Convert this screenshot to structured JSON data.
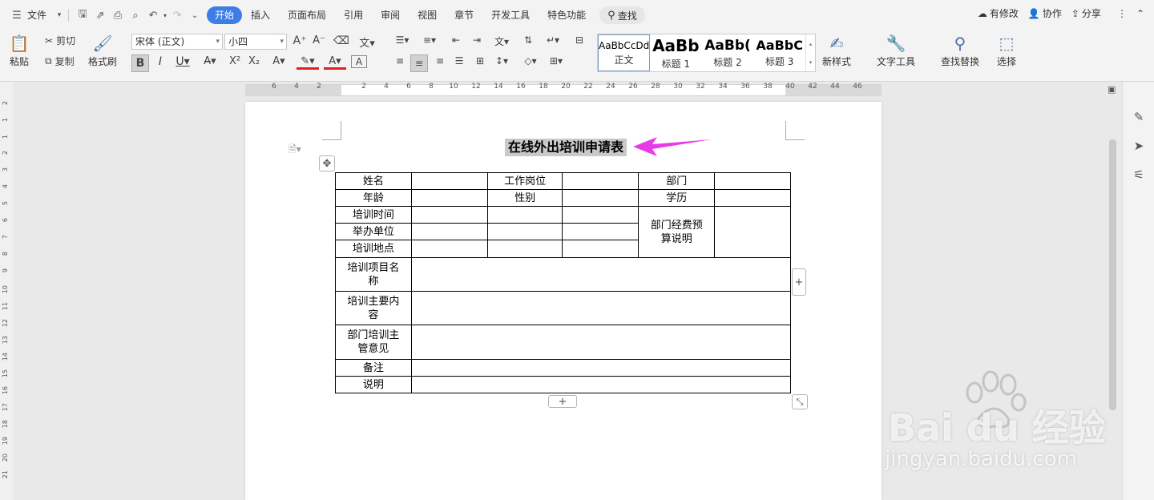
{
  "menu": {
    "file_label": "文件",
    "tabs": [
      "开始",
      "插入",
      "页面布局",
      "引用",
      "审阅",
      "视图",
      "章节",
      "开发工具",
      "特色功能"
    ],
    "active_tab": "开始",
    "search_label": "查找",
    "changes_label": "有修改",
    "collab_label": "协作",
    "share_label": "分享"
  },
  "ribbon": {
    "paste_label": "粘贴",
    "cut_label": "剪切",
    "copy_label": "复制",
    "format_painter_label": "格式刷",
    "font_name": "宋体 (正文)",
    "font_size": "小四",
    "styles": [
      {
        "preview": "AaBbCcDd",
        "name": "正文"
      },
      {
        "preview": "AaBb",
        "name": "标题 1"
      },
      {
        "preview": "AaBb(",
        "name": "标题 2"
      },
      {
        "preview": "AaBbC",
        "name": "标题 3"
      }
    ],
    "new_style_label": "新样式",
    "text_tools_label": "文字工具",
    "find_replace_label": "查找替换",
    "select_label": "选择"
  },
  "ruler": {
    "h_ticks": [
      "6",
      "4",
      "2",
      "2",
      "4",
      "6",
      "8",
      "10",
      "12",
      "14",
      "16",
      "18",
      "20",
      "22",
      "24",
      "26",
      "28",
      "30",
      "32",
      "34",
      "36",
      "38",
      "40",
      "42",
      "44",
      "46"
    ],
    "v_ticks": [
      "2",
      "1",
      "1",
      "2",
      "3",
      "4",
      "5",
      "6",
      "7",
      "8",
      "9",
      "10",
      "11",
      "12",
      "13",
      "14",
      "15",
      "16",
      "17",
      "18",
      "19",
      "20",
      "21"
    ]
  },
  "document": {
    "title": "在线外出培训申请表",
    "rows": {
      "r1": [
        "姓名",
        "",
        "工作岗位",
        "",
        "部门",
        ""
      ],
      "r2": [
        "年龄",
        "",
        "性别",
        "",
        "学历",
        ""
      ],
      "r3_label": "培训时间",
      "r4_label": "举办单位",
      "r5_label": "培训地点",
      "budget_label": "部门经费预算说明",
      "project_name": "培训项目名称",
      "main_content": "培训主要内容",
      "manager_opinion": "部门培训主管意见",
      "remarks": "备注",
      "notes": "说明"
    }
  },
  "watermark": {
    "brand": "Bai du 经验",
    "url": "jingyan.baidu.com"
  },
  "colors": {
    "accent": "#3c7de6",
    "arrow": "#e83be8",
    "title_highlight": "#c9c9c9"
  }
}
